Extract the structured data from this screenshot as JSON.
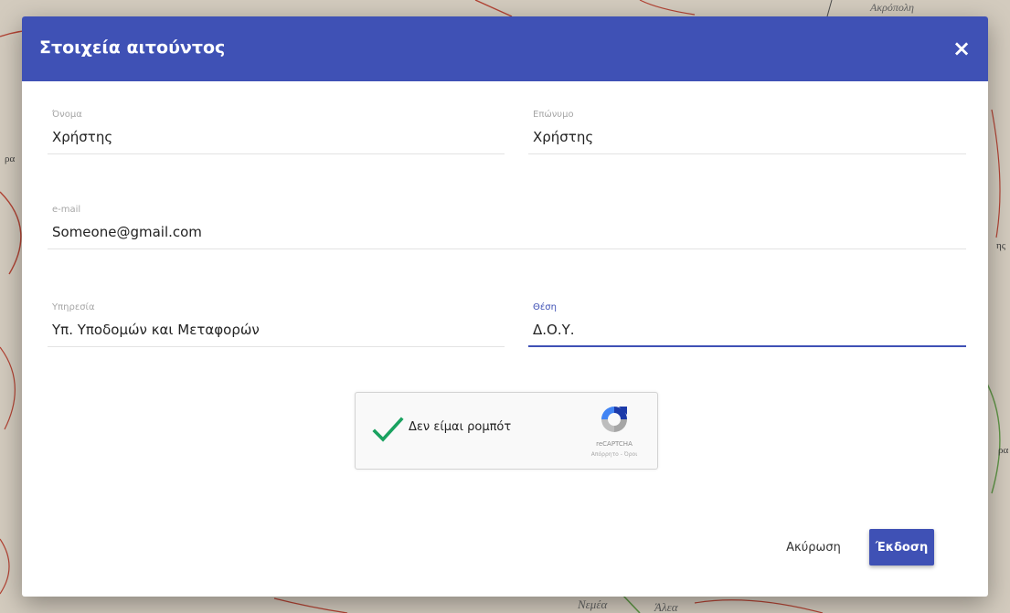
{
  "dialog": {
    "title": "Στοιχεία αιτούντος",
    "close_icon": "×"
  },
  "fields": {
    "onoma": {
      "label": "Όνομα",
      "value": "Χρήστης"
    },
    "eponymo": {
      "label": "Επώνυμο",
      "value": "Χρήστης"
    },
    "email": {
      "label": "e-mail",
      "value": "Someone@gmail.com"
    },
    "ypiresia": {
      "label": "Υπηρεσία",
      "value": "Υπ. Υποδομών και Μεταφορών"
    },
    "thesi": {
      "label": "Θέση",
      "value": "Δ.Ο.Υ.",
      "focused": true
    }
  },
  "recaptcha": {
    "checked": true,
    "label": "Δεν είμαι ρομπότ",
    "brand": "reCAPTCHA",
    "links": "Απόρρητο - Όροι"
  },
  "actions": {
    "cancel_label": "Ακύρωση",
    "submit_label": "Έκδοση"
  },
  "map": {
    "labels": {
      "top_right": "Ακρόπολη",
      "bottom_a": "Νεμέα",
      "bottom_b": "Άλεα",
      "left_a": "ρα",
      "right_a": "ης",
      "right_b": "ρα"
    }
  },
  "colors": {
    "primary": "#3f51b5",
    "check_green": "#1aa260"
  }
}
